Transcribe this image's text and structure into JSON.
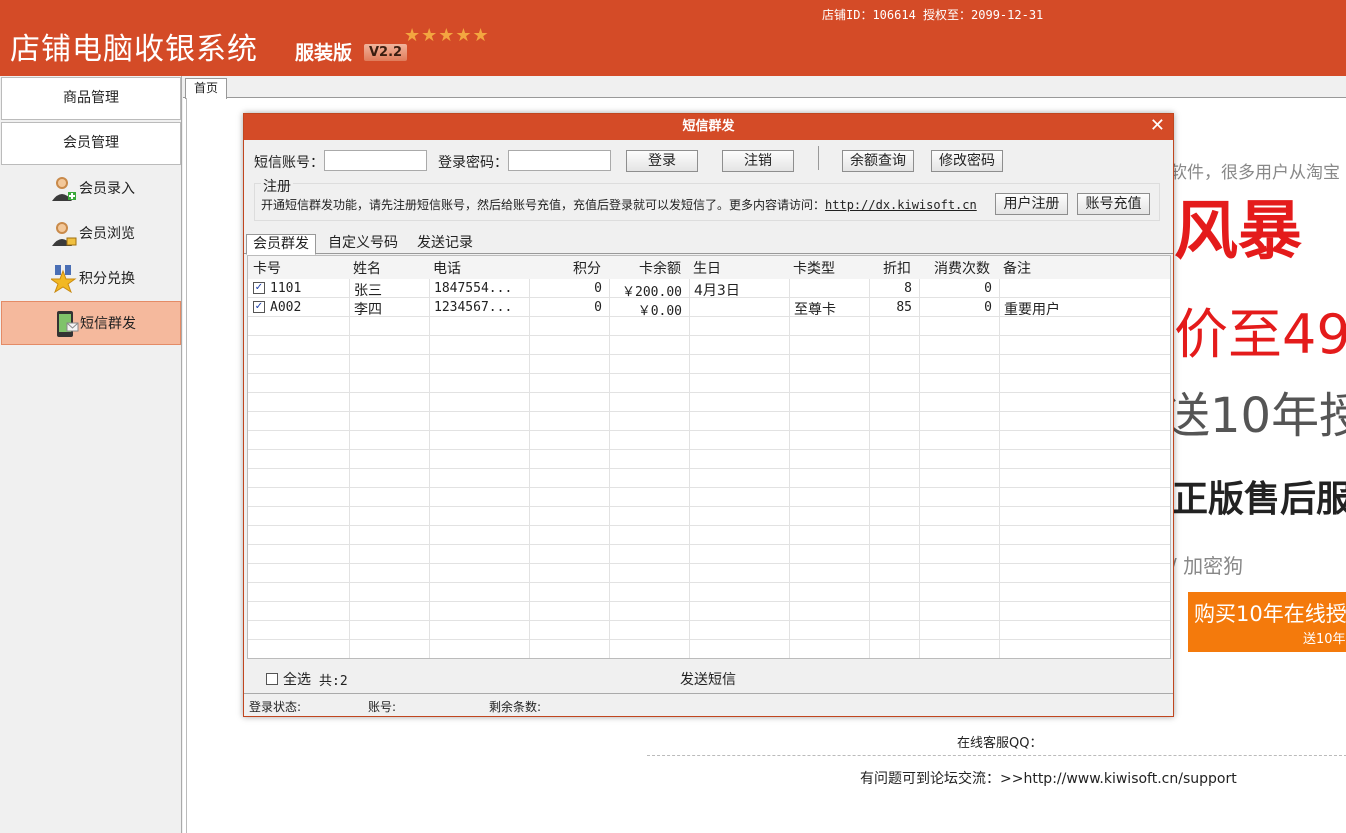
{
  "header": {
    "app_title": "店铺电脑收银系统",
    "edition": "服装版",
    "version": "V2.2",
    "stars": "★★★★★",
    "shop_info": "店铺ID：106614 授权至：2099-12-31"
  },
  "sidebar": {
    "categories": [
      {
        "label": "商品管理"
      },
      {
        "label": "会员管理"
      }
    ],
    "items": [
      {
        "label": "会员录入",
        "icon": "member-add-icon"
      },
      {
        "label": "会员浏览",
        "icon": "member-browse-icon"
      },
      {
        "label": "积分兑换",
        "icon": "points-star-icon"
      },
      {
        "label": "短信群发",
        "icon": "sms-phone-icon",
        "active": true
      }
    ]
  },
  "tabs": {
    "home": "首页"
  },
  "background_ad": {
    "line1": "软件，很多用户从淘宝",
    "line2": "风暴",
    "line3": "价至49",
    "line4": "送10年授",
    "line5": "正版售后服",
    "line6": "/ 加密狗",
    "buy_big": "购买10年在线授",
    "buy_small": "送10年",
    "qq_label": "在线客服QQ：",
    "support_text": "有问题可到论坛交流：>>http://www.kiwisoft.cn/support"
  },
  "dialog": {
    "title": "短信群发",
    "close": "✕",
    "sms_account_label": "短信账号：",
    "sms_account_value": "",
    "password_label": "登录密码：",
    "password_value": "",
    "login_button": "登录",
    "logout_button": "注销",
    "balance_button": "余额查询",
    "change_password_button": "修改密码",
    "register_legend": "注册",
    "register_text": "开通短信群发功能，请先注册短信账号，然后给账号充值，充值后登录就可以发短信了。更多内容请访问：",
    "register_link": "http://dx.kiwisoft.cn",
    "user_register_button": "用户注册",
    "recharge_button": "账号充值",
    "sub_tabs": [
      "会员群发",
      "自定义号码",
      "发送记录"
    ],
    "columns": [
      "卡号",
      "姓名",
      "电话",
      "积分",
      "卡余额",
      "生日",
      "卡类型",
      "折扣",
      "消费次数",
      "备注"
    ],
    "rows": [
      {
        "checked": true,
        "card": "1101",
        "name": "张三",
        "phone": "1847554...",
        "points": "0",
        "balance": "￥200.00",
        "birthday": "4月3日",
        "card_type": "",
        "discount": "8",
        "visits": "0",
        "note": ""
      },
      {
        "checked": true,
        "card": "A002",
        "name": "李四",
        "phone": "1234567...",
        "points": "0",
        "balance": "￥0.00",
        "birthday": "",
        "card_type": "至尊卡",
        "discount": "85",
        "visits": "0",
        "note": "重要用户"
      }
    ],
    "select_all_label": "全选",
    "total_label": "共:2",
    "send_button": "发送短信",
    "status_login": "登录状态:",
    "status_account": "账号:",
    "status_remaining": "剩余条数:"
  },
  "colors": {
    "brand": "#d44b27",
    "active_item": "#f5b99d",
    "ad_red": "#e41b1b",
    "ad_orange": "#f47a0c"
  }
}
